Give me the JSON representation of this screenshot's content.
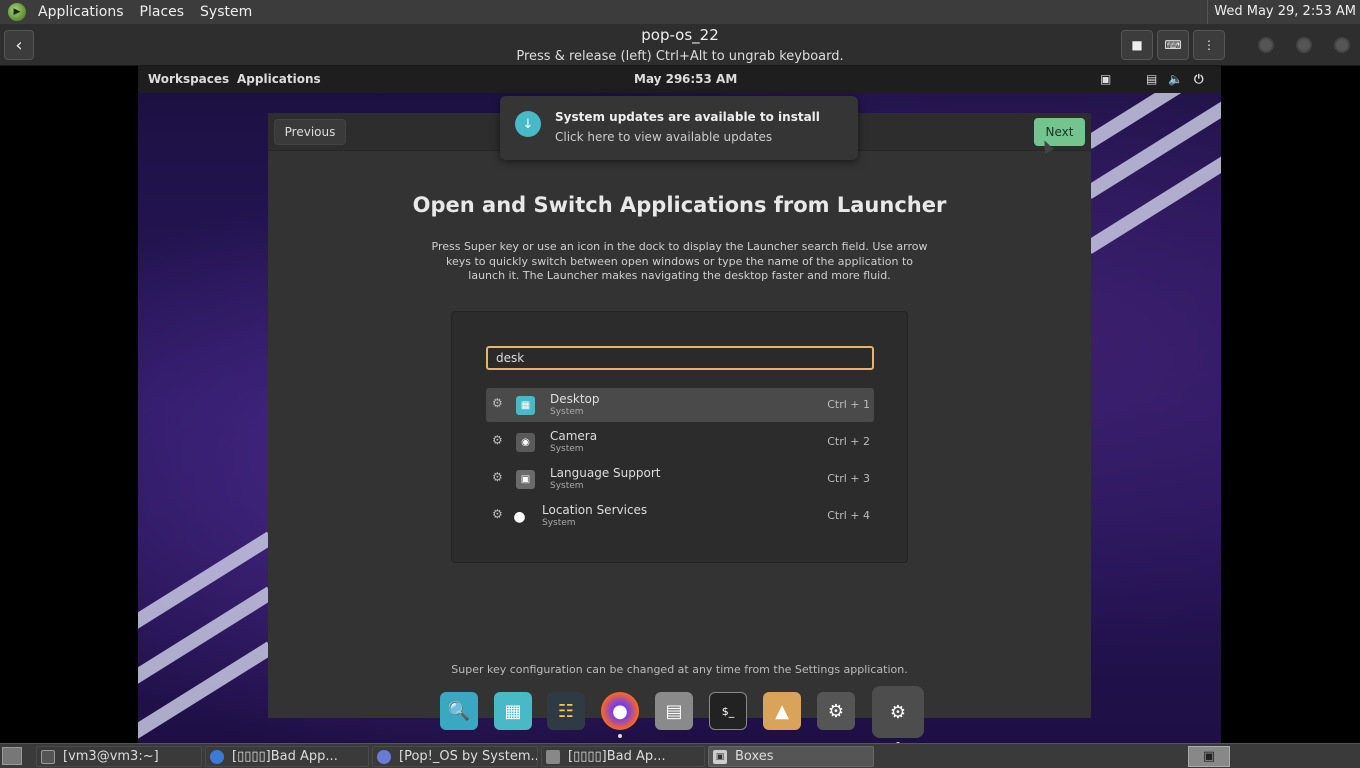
{
  "host_panel": {
    "menus": [
      "Applications",
      "Places",
      "System"
    ],
    "clock": "Wed May 29,  2:53 AM"
  },
  "boxes_header": {
    "title": "pop-os_22",
    "subtitle": "Press & release (left) Ctrl+Alt to ungrab keyboard."
  },
  "pop_bar": {
    "workspaces": "Workspaces",
    "applications": "Applications",
    "date": "May 29",
    "time": "6:53 AM"
  },
  "notification": {
    "title": "System updates are available to install",
    "body": "Click here to view available updates"
  },
  "setup": {
    "previous": "Previous",
    "next": "Next",
    "title": "Open and Switch Applications from Launcher",
    "description": "Press Super key or use an icon in the dock to display the Launcher search field. Use arrow keys to quickly switch between open windows or type the name of the application to launch it. The Launcher makes navigating the desktop faster and more fluid.",
    "footer": "Super key configuration can be changed at any time from the Settings application."
  },
  "launcher": {
    "search_value": "desk",
    "results": [
      {
        "name": "Desktop",
        "category": "System",
        "shortcut": "Ctrl + 1"
      },
      {
        "name": "Camera",
        "category": "System",
        "shortcut": "Ctrl + 2"
      },
      {
        "name": "Language Support",
        "category": "System",
        "shortcut": "Ctrl + 3"
      },
      {
        "name": "Location Services",
        "category": "System",
        "shortcut": "Ctrl + 4"
      }
    ]
  },
  "taskbar": {
    "tasks": [
      "[vm3@vm3:~]",
      "[▯▯▯▯]Bad App...",
      "[Pop!_OS by System...",
      "[▯▯▯▯]Bad Ap...",
      "Boxes"
    ]
  },
  "colors": {
    "accent_green": "#73c48f",
    "search_border": "#e8b36b",
    "pop_teal": "#48b9c7"
  }
}
